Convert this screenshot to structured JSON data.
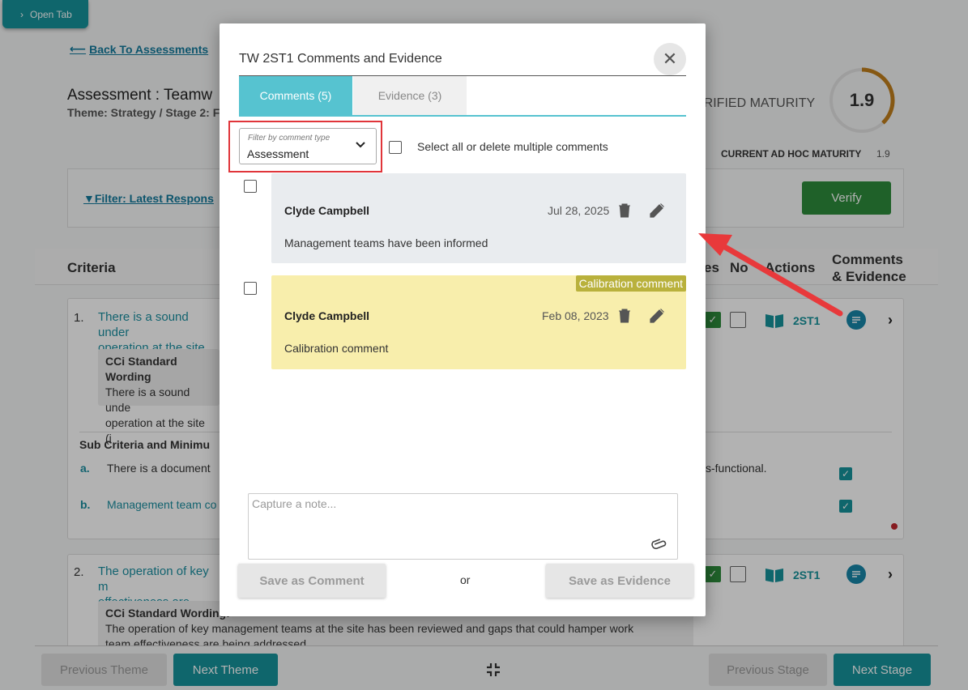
{
  "background": {
    "open_tab_label": "Open Tab",
    "back_link": "Back To Assessments",
    "assessment_title": "Assessment : Teamw",
    "assessment_sub": "Theme: Strategy / Stage 2: F",
    "verified_label": "ERIFIED MATURITY",
    "maturity_value": "1.9",
    "maturity_fraction": 0.38,
    "adhoc_label": "CURRENT AD HOC MATURITY",
    "adhoc_value": "1.9",
    "filter_link": "Filter: Latest Respons",
    "verify_button": "Verify",
    "headers": {
      "criteria": "Criteria",
      "yes": "es",
      "no": "No",
      "actions": "Actions",
      "comments_evidence_1": "Comments",
      "comments_evidence_2": "& Evidence"
    },
    "criteria1": {
      "num": "1.",
      "text_line1": "There is a sound under",
      "text_line2": "operation at the site (in",
      "wording_title": "CCi Standard Wording",
      "wording_line1": "There is a sound unde",
      "wording_line2": "operation at the site (i",
      "code": "2ST1",
      "sub_heading": "Sub Criteria and Minimu",
      "sub_a_letter": "a.",
      "sub_a_text": "There is a document",
      "sub_a_tail": "s-functional.",
      "sub_b_letter": "b.",
      "sub_b_text": "Management team co"
    },
    "criteria2": {
      "num": "2.",
      "text_line1": "The operation of key m",
      "text_line2": "effectiveness are being",
      "wording_title": "CCi Standard Wording:",
      "wording_line1": "The operation of key management teams at the site has been reviewed and gaps that could hamper work",
      "wording_line2": "team effectiveness are being addressed",
      "code": "2ST1"
    },
    "footer": {
      "prev_theme": "Previous Theme",
      "next_theme": "Next Theme",
      "prev_stage": "Previous Stage",
      "next_stage": "Next Stage"
    }
  },
  "modal": {
    "title": "TW 2ST1 Comments and Evidence",
    "close_symbol": "✕",
    "tabs": [
      {
        "label": "Comments (5)"
      },
      {
        "label": "Evidence (3)"
      }
    ],
    "filter": {
      "label": "Filter by comment type",
      "value": "Assessment"
    },
    "select_all_label": "Select all or delete multiple comments",
    "comments": [
      {
        "author": "Clyde Campbell",
        "date": "Jul 28, 2025",
        "text": "Management teams have been informed"
      },
      {
        "author": "Clyde Campbell",
        "date": "Feb 08, 2023",
        "text": "Calibration comment",
        "tag": "Calibration comment"
      }
    ],
    "note_placeholder": "Capture a note...",
    "save_comment": "Save as Comment",
    "or_text": "or",
    "save_evidence": "Save as Evidence"
  },
  "colors": {
    "accent": "#16939b",
    "tab_active": "#56c3d0",
    "calibration": "#f8eeac",
    "calibration_tag": "#b9b13c",
    "arrow": "#e8393b",
    "verify": "#2d8b3c"
  }
}
